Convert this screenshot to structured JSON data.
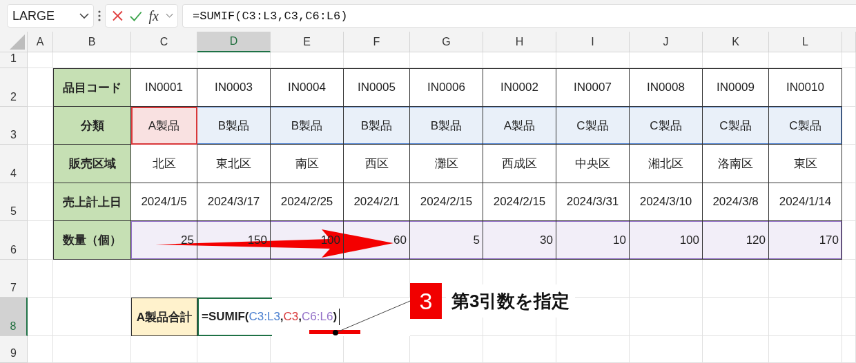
{
  "name_box": {
    "value": "LARGE"
  },
  "formula_bar": {
    "fx": "fx",
    "formula": "=SUMIF(C3:L3,C3,C6:L6)"
  },
  "columns": [
    {
      "label": "A",
      "selected": false
    },
    {
      "label": "B",
      "selected": false
    },
    {
      "label": "C",
      "selected": false
    },
    {
      "label": "D",
      "selected": true
    },
    {
      "label": "E",
      "selected": false
    },
    {
      "label": "F",
      "selected": false
    },
    {
      "label": "G",
      "selected": false
    },
    {
      "label": "H",
      "selected": false
    },
    {
      "label": "I",
      "selected": false
    },
    {
      "label": "J",
      "selected": false
    },
    {
      "label": "K",
      "selected": false
    },
    {
      "label": "L",
      "selected": false
    }
  ],
  "row_numbers": [
    {
      "label": "1",
      "selected": false
    },
    {
      "label": "2",
      "selected": false
    },
    {
      "label": "3",
      "selected": false
    },
    {
      "label": "4",
      "selected": false
    },
    {
      "label": "5",
      "selected": false
    },
    {
      "label": "6",
      "selected": false
    },
    {
      "label": "7",
      "selected": false
    },
    {
      "label": "8",
      "selected": true
    },
    {
      "label": "9",
      "selected": false
    }
  ],
  "table": {
    "rows": [
      {
        "kind": "text",
        "header": "品目コード",
        "cells": [
          {
            "text": "IN0001"
          },
          {
            "text": "IN0003"
          },
          {
            "text": "IN0004"
          },
          {
            "text": "IN0005"
          },
          {
            "text": "IN0006"
          },
          {
            "text": "IN0002"
          },
          {
            "text": "IN0007"
          },
          {
            "text": "IN0008"
          },
          {
            "text": "IN0009"
          },
          {
            "text": "IN0010"
          }
        ]
      },
      {
        "kind": "text",
        "header": "分類",
        "color": "#4a7fd0",
        "cells": [
          {
            "text": "A製品",
            "color": "#d9383a"
          },
          {
            "text": "B製品"
          },
          {
            "text": "B製品"
          },
          {
            "text": "B製品"
          },
          {
            "text": "B製品"
          },
          {
            "text": "A製品"
          },
          {
            "text": "C製品"
          },
          {
            "text": "C製品"
          },
          {
            "text": "C製品"
          },
          {
            "text": "C製品"
          }
        ]
      },
      {
        "kind": "text",
        "header": "販売区域",
        "cells": [
          {
            "text": "北区"
          },
          {
            "text": "東北区"
          },
          {
            "text": "南区"
          },
          {
            "text": "西区"
          },
          {
            "text": "灘区"
          },
          {
            "text": "西成区"
          },
          {
            "text": "中央区"
          },
          {
            "text": "湘北区"
          },
          {
            "text": "洛南区"
          },
          {
            "text": "東区"
          }
        ]
      },
      {
        "kind": "text",
        "header": "売上計上日",
        "cells": [
          {
            "text": "2024/1/5"
          },
          {
            "text": "2024/3/17"
          },
          {
            "text": "2024/2/25"
          },
          {
            "text": "2024/2/1"
          },
          {
            "text": "2024/2/15"
          },
          {
            "text": "2024/2/15"
          },
          {
            "text": "2024/3/31"
          },
          {
            "text": "2024/3/10"
          },
          {
            "text": "2024/3/8"
          },
          {
            "text": "2024/1/14"
          }
        ]
      },
      {
        "kind": "number",
        "header": "数量（個）",
        "color": "#9370c8",
        "cells": [
          {
            "text": "25"
          },
          {
            "text": "150"
          },
          {
            "text": "100"
          },
          {
            "text": "60"
          },
          {
            "text": "5"
          },
          {
            "text": "30"
          },
          {
            "text": "10"
          },
          {
            "text": "100"
          },
          {
            "text": "120"
          },
          {
            "text": "170"
          }
        ]
      }
    ]
  },
  "total": {
    "label": "A製品合計",
    "formula_parts": [
      {
        "text": "=SUMIF("
      },
      {
        "text": "C3:L3",
        "color": "#4a7fd0"
      },
      {
        "text": ","
      },
      {
        "text": "C3",
        "color": "#d9383a"
      },
      {
        "text": ","
      },
      {
        "text": "C6:L6",
        "color": "#9370c8"
      },
      {
        "text": ")"
      }
    ]
  },
  "callout": {
    "number": "3",
    "text": "第3引数を指定"
  }
}
